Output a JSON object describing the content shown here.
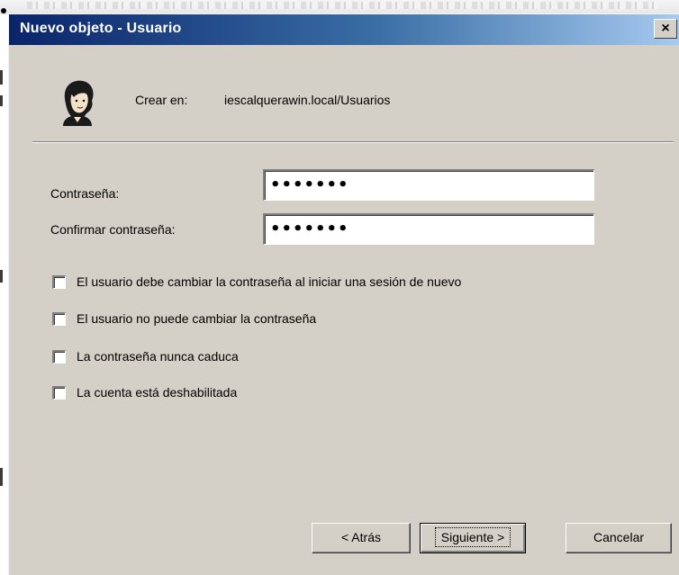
{
  "dialog": {
    "title": "Nuevo objeto - Usuario",
    "close_glyph": "×"
  },
  "header": {
    "icon": "user-icon",
    "create_in_label": "Crear en:",
    "create_in_value": "iescalquerawin.local/Usuarios"
  },
  "form": {
    "password_label": "Contraseña:",
    "password_value": "•••••••",
    "confirm_label": "Confirmar contraseña:",
    "confirm_value": "•••••••"
  },
  "options": [
    {
      "label": "El usuario debe cambiar la contraseña al iniciar una sesión de nuevo",
      "checked": false
    },
    {
      "label": "El usuario no puede cambiar la contraseña",
      "checked": false
    },
    {
      "label": "La contraseña nunca caduca",
      "checked": false
    },
    {
      "label": "La cuenta está deshabilitada",
      "checked": false
    }
  ],
  "buttons": {
    "back": "< Atrás",
    "next": "Siguiente >",
    "cancel": "Cancelar"
  },
  "colors": {
    "titlebar_start": "#0a246a",
    "titlebar_end": "#a6caf0",
    "dialog_bg": "#d4d0c8"
  }
}
